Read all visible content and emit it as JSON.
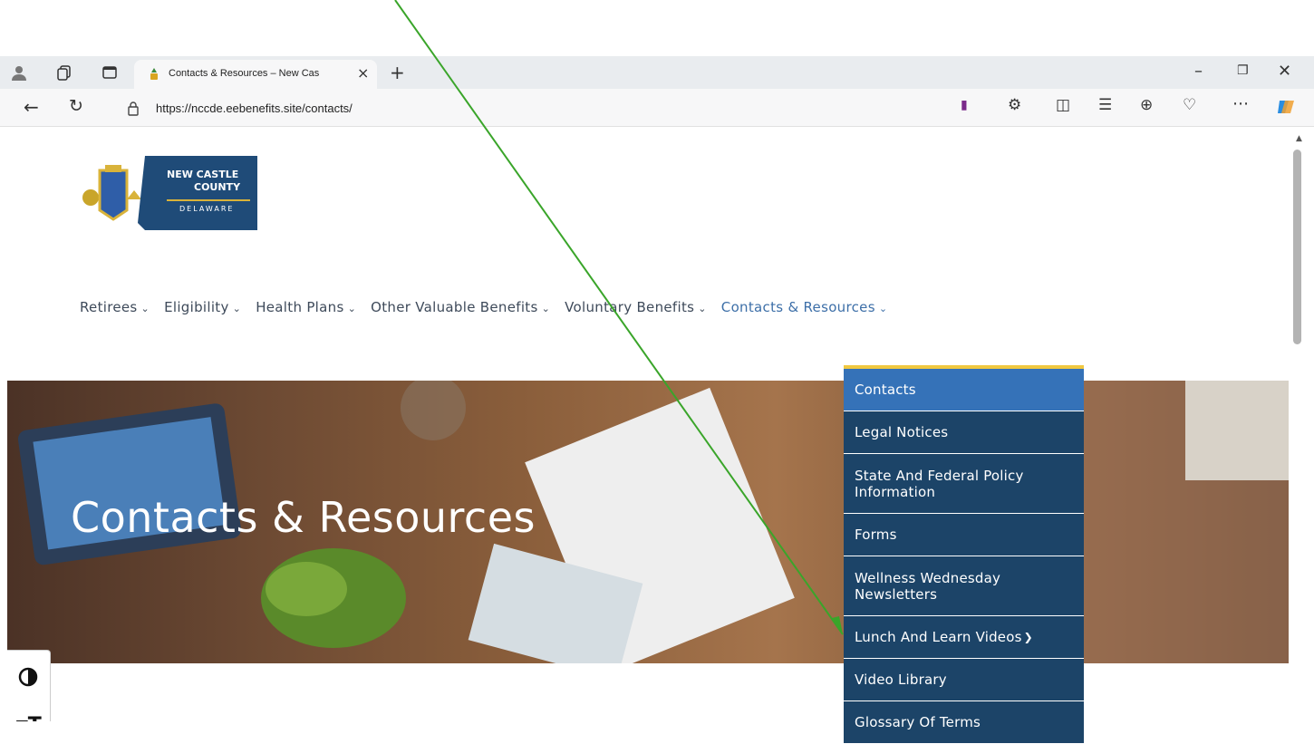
{
  "browser": {
    "tab_title": "Contacts & Resources – New Cas",
    "url": "https://nccde.eebenefits.site/contacts/",
    "tab_close": "×",
    "new_tab": "+",
    "window_controls": {
      "minimize": "–",
      "restore": "❐",
      "close": "✕"
    }
  },
  "logo": {
    "line1": "NEW CASTLE",
    "line2": "COUNTY",
    "line3": "DELAWARE"
  },
  "nav": {
    "items": [
      {
        "label": "Retirees"
      },
      {
        "label": "Eligibility"
      },
      {
        "label": "Health Plans"
      },
      {
        "label": "Other Valuable Benefits"
      },
      {
        "label": "Voluntary Benefits"
      },
      {
        "label": "Contacts & Resources"
      }
    ],
    "chevron": "❯"
  },
  "hero": {
    "title": "Contacts & Resources"
  },
  "dropdown": {
    "items": [
      {
        "label": "Contacts"
      },
      {
        "label": "Legal Notices"
      },
      {
        "label": "State And Federal Policy Information"
      },
      {
        "label": "Forms"
      },
      {
        "label": "Wellness Wednesday Newsletters"
      },
      {
        "label": "Lunch And Learn Videos"
      },
      {
        "label": "Video Library"
      },
      {
        "label": "Glossary Of Terms"
      }
    ],
    "submenu_marker": "❯"
  },
  "accessibility": {
    "contrast_icon": "◐",
    "text_size_icon": "ᴛT"
  },
  "colors": {
    "accent": "#1c4468",
    "active_item": "#3572b8",
    "dropdown_border": "#f0c840",
    "nav_active": "#3d6fa8",
    "annotation_arrow": "#3aa52a"
  }
}
